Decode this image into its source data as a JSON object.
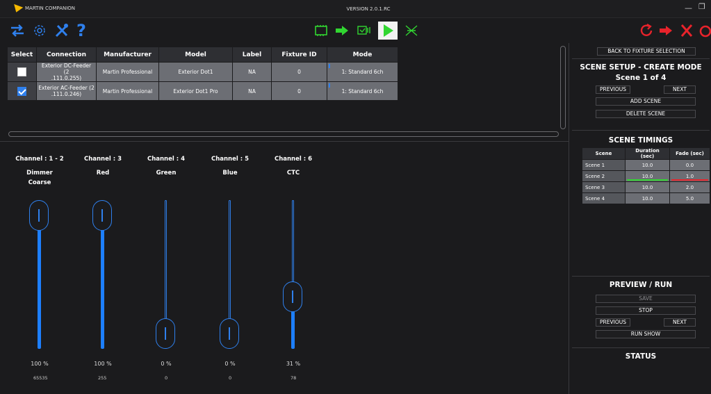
{
  "app": {
    "title": "MARTIN COMPANION",
    "version": "VERSION 2.0.1.RC"
  },
  "colors": {
    "accent": "#2f80ed",
    "green": "#31d631",
    "red": "#e8232b",
    "logo": "#f6b800"
  },
  "toolbar": {
    "left_icons": [
      "swap-arrows-icon",
      "gear-icon",
      "tools-icon",
      "help-icon"
    ],
    "center_icons": [
      "chip-icon",
      "arrow-right-green-icon",
      "dmx-icon",
      "play-icon",
      "cross-pattern-icon"
    ],
    "right_icons": [
      "refresh-red-icon",
      "arrow-right-red-icon",
      "cross-red-icon",
      "power-red-icon"
    ],
    "help_label": "?"
  },
  "fixture_table": {
    "headers": [
      "Select",
      "Connection",
      "Manufacturer",
      "Model",
      "Label",
      "Fixture ID",
      "Mode"
    ],
    "rows": [
      {
        "checked": false,
        "connection": "Exterior DC-Feeder (2",
        "connection2": ".111.0.255)",
        "manufacturer": "Martin Professional",
        "model": "Exterior Dot1",
        "label": "NA",
        "fixture_id": "0",
        "mode": "1: Standard 6ch"
      },
      {
        "checked": true,
        "connection": "Exterior AC-Feeder (2",
        "connection2": ".111.0.246)",
        "manufacturer": "Martin Professional",
        "model": "Exterior Dot1 Pro",
        "label": "NA",
        "fixture_id": "0",
        "mode": "1: Standard 6ch"
      }
    ]
  },
  "channels": [
    {
      "title": "Channel : 1 - 2",
      "sub1": "Dimmer",
      "sub2": "Coarse",
      "percent_label": "100 %",
      "raw": "65535",
      "level": 1.0
    },
    {
      "title": "Channel : 3",
      "sub1": "Red",
      "sub2": "",
      "percent_label": "100 %",
      "raw": "255",
      "level": 1.0
    },
    {
      "title": "Channel : 4",
      "sub1": "Green",
      "sub2": "",
      "percent_label": "0 %",
      "raw": "0",
      "level": 0.0
    },
    {
      "title": "Channel : 5",
      "sub1": "Blue",
      "sub2": "",
      "percent_label": "0 %",
      "raw": "0",
      "level": 0.0
    },
    {
      "title": "Channel : 6",
      "sub1": "CTC",
      "sub2": "",
      "percent_label": "31 %",
      "raw": "78",
      "level": 0.31
    }
  ],
  "scene_setup": {
    "back_label": "BACK TO FIXTURE SELECTION",
    "title": "SCENE SETUP - CREATE MODE",
    "scene_counter": "Scene 1 of 4",
    "previous_label": "PREVIOUS",
    "next_label": "NEXT",
    "add_label": "ADD SCENE",
    "delete_label": "DELETE SCENE"
  },
  "timings": {
    "title": "SCENE TIMINGS",
    "headers": [
      "Scene",
      "Duration (sec)",
      "Fade (sec)"
    ],
    "rows": [
      {
        "scene": "Scene 1",
        "duration": "10.0",
        "fade": "0.0"
      },
      {
        "scene": "Scene 2",
        "duration": "10.0",
        "fade": "1.0"
      },
      {
        "scene": "Scene 3",
        "duration": "10.0",
        "fade": "2.0"
      },
      {
        "scene": "Scene 4",
        "duration": "10.0",
        "fade": "5.0"
      }
    ]
  },
  "preview": {
    "title": "PREVIEW / RUN",
    "save_label": "SAVE",
    "stop_label": "STOP",
    "previous_label": "PREVIOUS",
    "next_label": "NEXT",
    "run_label": "RUN SHOW"
  },
  "status": {
    "title": "STATUS"
  }
}
